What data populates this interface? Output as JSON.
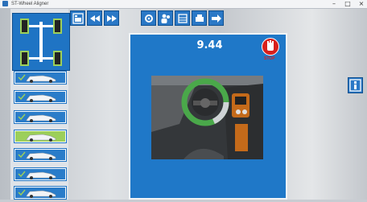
{
  "window": {
    "title": "ST-Wheel Aligner",
    "controls": [
      "minimize",
      "maximize",
      "close"
    ]
  },
  "timer": {
    "value": "9.44"
  },
  "stop_button": {
    "label": "STOP",
    "color": "#d8201c"
  },
  "colors": {
    "accent": "#1f78c8",
    "active": "#9ccf5a"
  },
  "toolbar_left": [
    "home-icon",
    "rewind-icon",
    "fast-forward-icon"
  ],
  "toolbar_right": [
    "settings-icon",
    "users-icon",
    "database-icon",
    "print-icon",
    "exit-icon"
  ],
  "sidebar": {
    "items": [
      {
        "name": "nav-vehicle-check",
        "icon": "car-check-icon"
      },
      {
        "name": "nav-vehicle-lift",
        "icon": "car-lift-icon"
      },
      {
        "name": "nav-measurement",
        "icon": "car-measure-icon"
      },
      {
        "name": "nav-steering",
        "icon": "car-steer-icon",
        "active": true
      },
      {
        "name": "nav-display",
        "icon": "car-display-icon"
      },
      {
        "name": "nav-adjust",
        "icon": "wrench-car-icon"
      },
      {
        "name": "nav-report",
        "icon": "car-report-icon"
      }
    ]
  },
  "right_tool": {
    "icon": "info-icon"
  }
}
